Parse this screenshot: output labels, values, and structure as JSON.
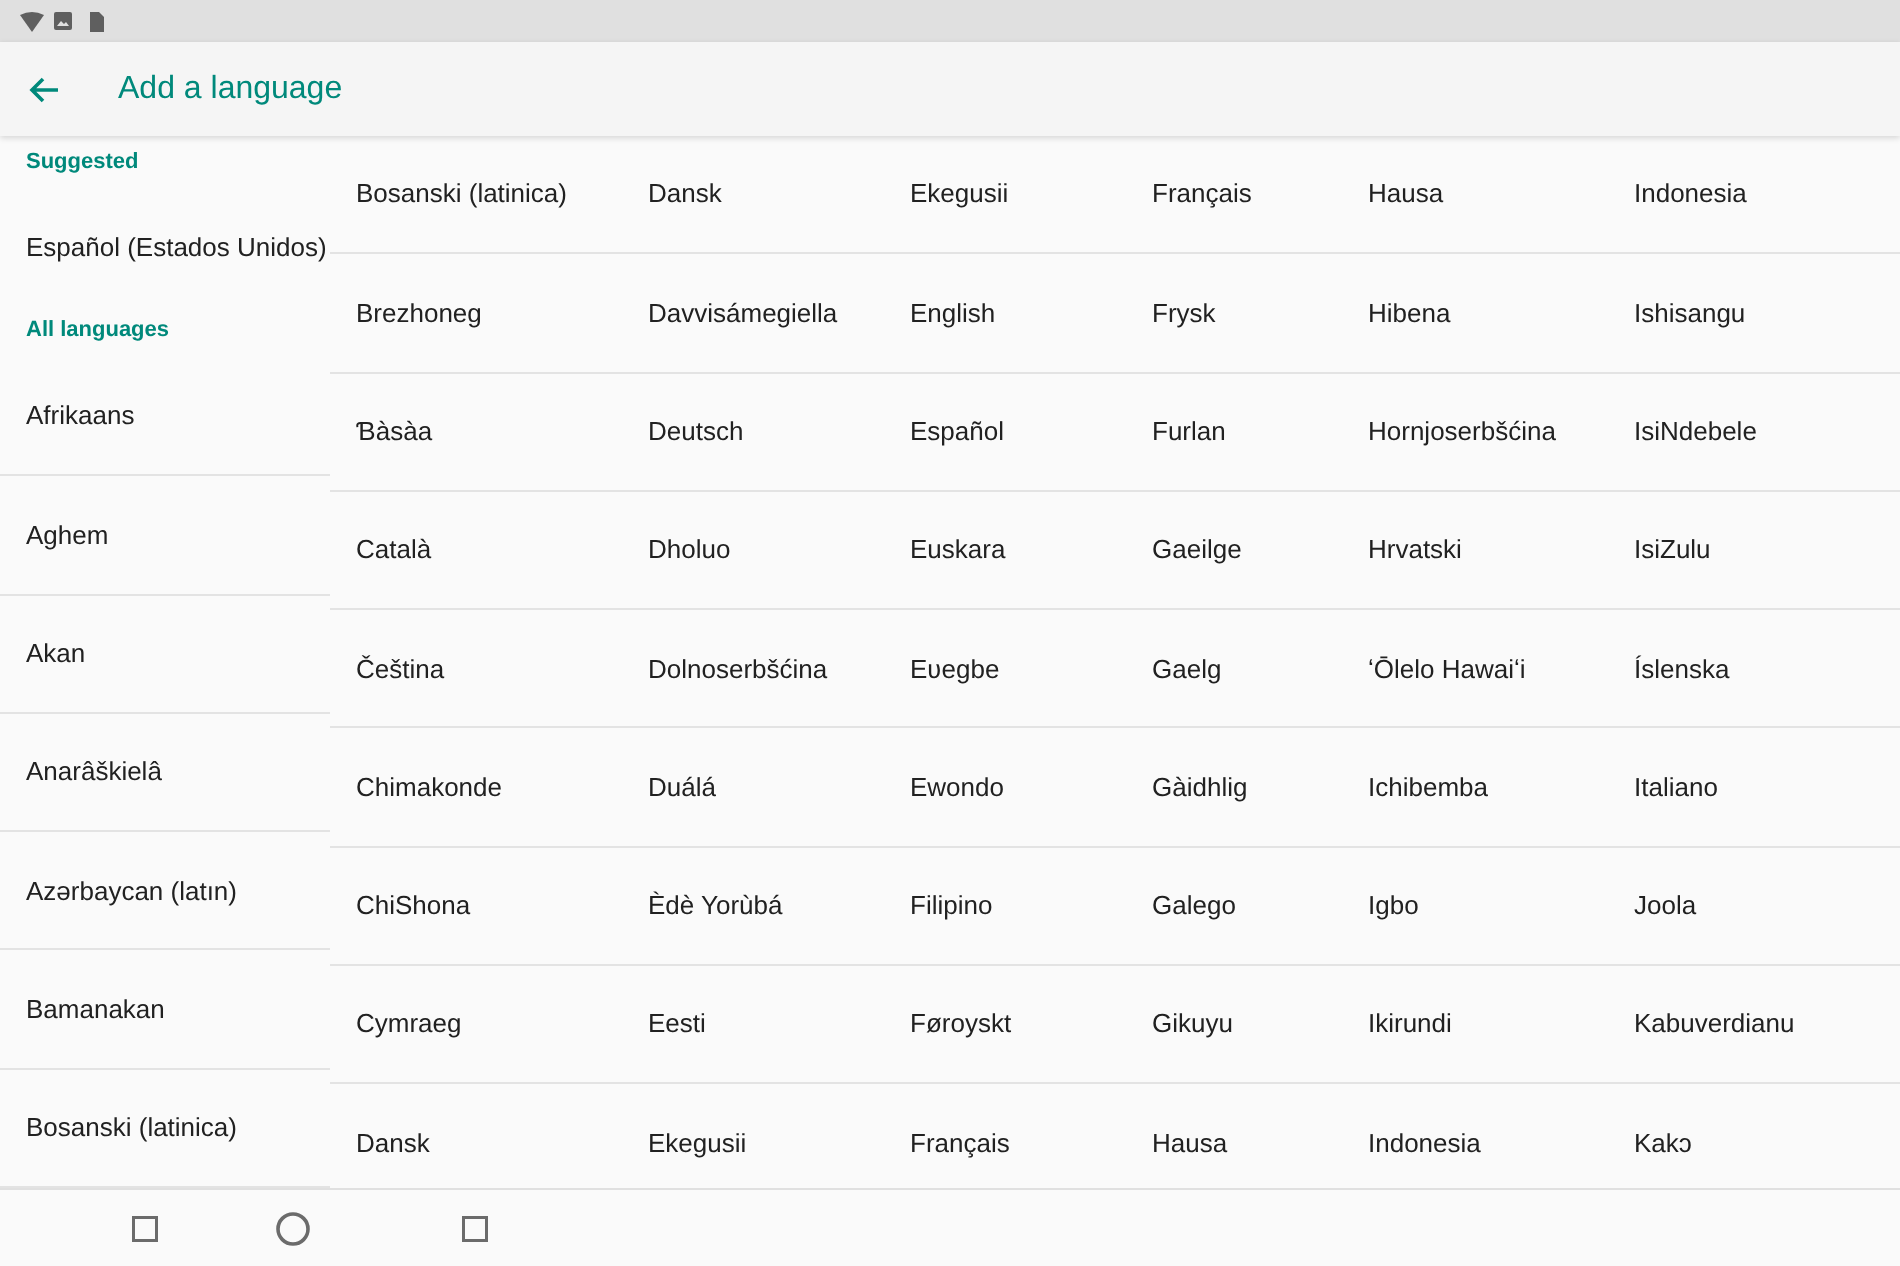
{
  "app_bar": {
    "title": "Add a language"
  },
  "language_list": [
    {
      "kind": "header",
      "label": "Suggested"
    },
    {
      "kind": "suggested",
      "label": "Español (Estados Unidos)"
    },
    {
      "kind": "header",
      "label": "All languages"
    },
    {
      "kind": "language",
      "label": "Afrikaans"
    },
    {
      "kind": "language",
      "label": "Aghem"
    },
    {
      "kind": "language",
      "label": "Akan"
    },
    {
      "kind": "language",
      "label": "Anarâškielâ"
    },
    {
      "kind": "language",
      "label": "Azərbaycan (latın)"
    },
    {
      "kind": "language",
      "label": "Bamanakan"
    },
    {
      "kind": "language",
      "label": "Bosanski (latinica)"
    }
  ],
  "language_columns": [
    {
      "items": [
        "Bosanski (latinica)",
        "Brezhoneg",
        "Ɓàsàa",
        "Català",
        "Čeština",
        "Chimakonde",
        "ChiShona",
        "Cymraeg",
        "Dansk"
      ]
    },
    {
      "items": [
        "Dansk",
        "Davvisámegiella",
        "Deutsch",
        "Dholuo",
        "Dolnoserbšćina",
        "Duálá",
        "Èdè Yorùbá",
        "Eesti",
        "Ekegusii"
      ]
    },
    {
      "items": [
        "Ekegusii",
        "English",
        "Español",
        "Euskara",
        "Eʋegbe",
        "Ewondo",
        "Filipino",
        "Føroyskt",
        "Français"
      ]
    },
    {
      "items": [
        "Français",
        "Frysk",
        "Furlan",
        "Gaeilge",
        "Gaelg",
        "Gàidhlig",
        "Galego",
        "Gikuyu",
        "Hausa"
      ]
    },
    {
      "items": [
        "Hausa",
        "Hibena",
        "Hornjoserbšćina",
        "Hrvatski",
        "ʻŌlelo Hawaiʻi",
        "Ichibemba",
        "Igbo",
        "Ikirundi",
        "Indonesia"
      ]
    },
    {
      "items": [
        "Indonesia",
        "Ishisangu",
        "IsiNdebele",
        "IsiZulu",
        "Íslenska",
        "Italiano",
        "Joola",
        "Kabuverdianu",
        "Kakɔ"
      ]
    }
  ]
}
